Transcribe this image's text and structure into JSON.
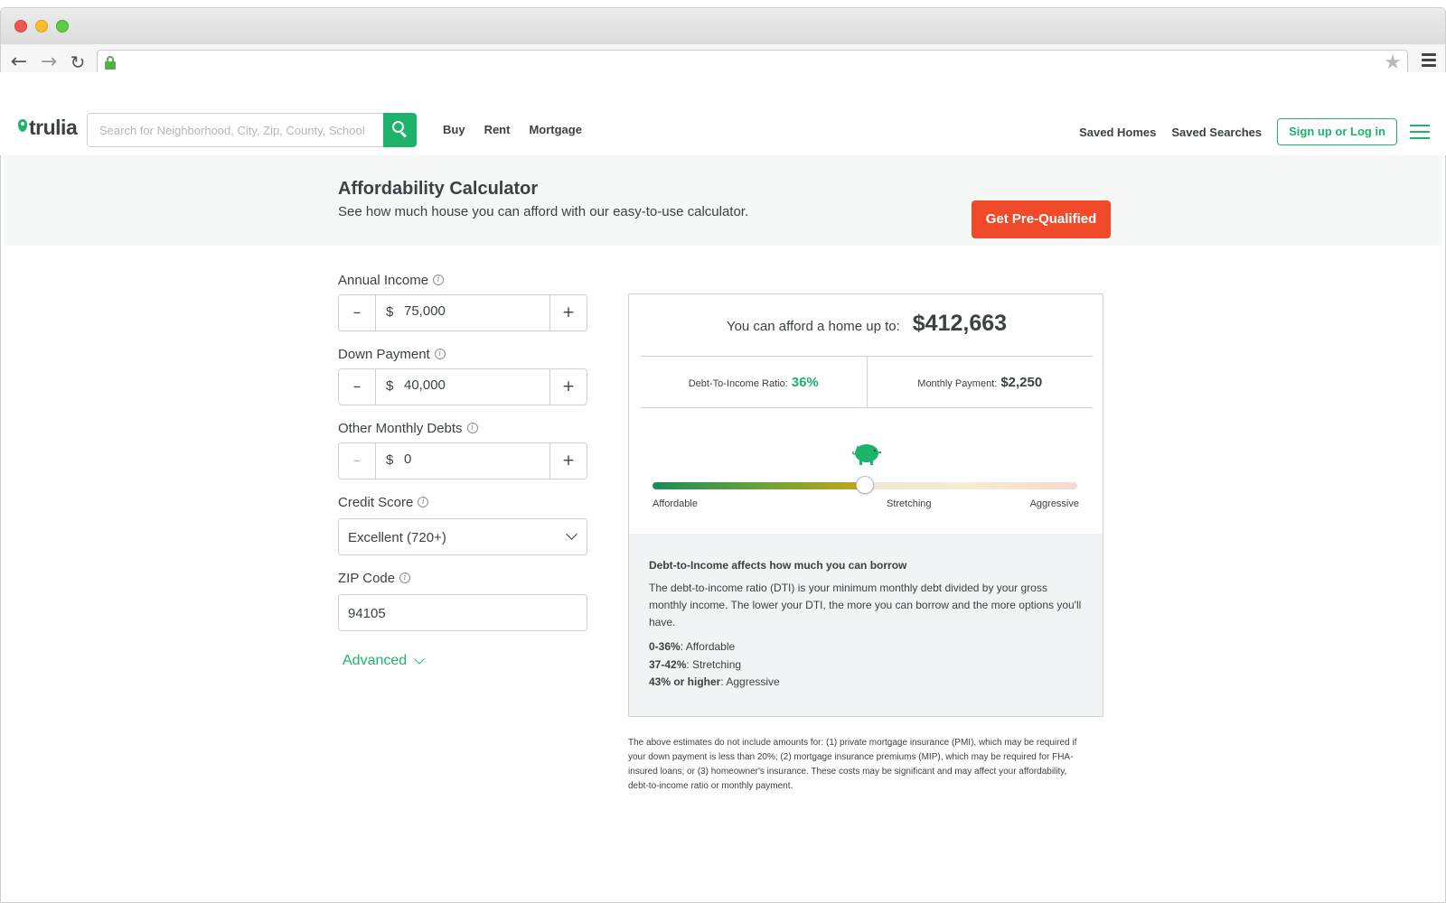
{
  "header": {
    "logo": "trulia",
    "search_placeholder": "Search for Neighborhood, City, Zip, County, School",
    "nav": [
      "Buy",
      "Rent",
      "Mortgage"
    ],
    "saved_homes": "Saved Homes",
    "saved_searches": "Saved Searches",
    "signup": "Sign up or Log in"
  },
  "banner": {
    "title": "Affordability Calculator",
    "subtitle": "See how much house you can afford with our easy-to-use calculator.",
    "cta": "Get Pre-Qualified"
  },
  "form": {
    "annual_income": {
      "label": "Annual Income",
      "currency": "$",
      "value": "75,000"
    },
    "down_payment": {
      "label": "Down Payment",
      "currency": "$",
      "value": "40,000"
    },
    "other_debts": {
      "label": "Other Monthly Debts",
      "currency": "$",
      "value": "0"
    },
    "credit_score": {
      "label": "Credit Score",
      "value": "Excellent (720+)"
    },
    "zip": {
      "label": "ZIP Code",
      "value": "94105"
    },
    "advanced": "Advanced",
    "minus": "–",
    "plus": "+"
  },
  "results": {
    "afford_label": "You can afford a home up to:",
    "afford_value": "$412,663",
    "dti_label": "Debt-To-Income Ratio:",
    "dti_value": "36%",
    "monthly_label": "Monthly Payment:",
    "monthly_value": "$2,250",
    "slider_position": 0.5,
    "slider_labels": [
      "Affordable",
      "Stretching",
      "Aggressive"
    ],
    "info_title": "Debt-to-Income affects how much you can borrow",
    "info_body": "The debt-to-income ratio (DTI) is your minimum monthly debt divided by your gross monthly income. The lower your DTI, the more you can borrow and the more options you'll have.",
    "ranges": [
      {
        "range": "0-36%",
        "label": ": Affordable"
      },
      {
        "range": "37-42%",
        "label": ": Stretching"
      },
      {
        "range": "43% or higher",
        "label": ": Aggressive"
      }
    ]
  },
  "disclaimer": "The above estimates do not include amounts for: (1) private mortgage insurance (PMI), which may be required if your down payment is less than 20%; (2) mortgage insurance premiums (MIP), which may be required for FHA-insured loans; or (3) homeowner's insurance. These costs may be significant and may affect your affordability, debt-to-income ratio or monthly payment.",
  "colors": {
    "brand_green": "#1db36b",
    "cta_orange": "#f04a2a"
  }
}
